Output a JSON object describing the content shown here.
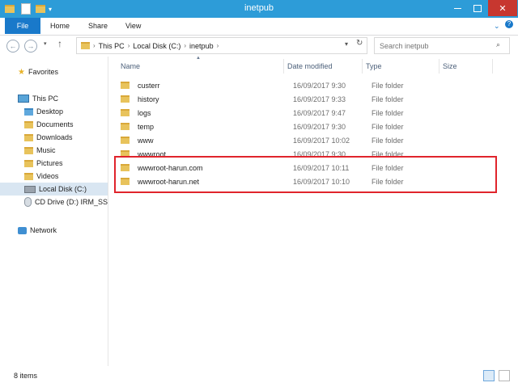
{
  "window": {
    "title": "inetpub"
  },
  "ribbon": {
    "tabs": [
      "File",
      "Home",
      "Share",
      "View"
    ]
  },
  "address": {
    "crumbs": [
      "This PC",
      "Local Disk (C:)",
      "inetpub"
    ],
    "search_placeholder": "Search inetpub"
  },
  "nav": {
    "favorites": "Favorites",
    "this_pc": "This PC",
    "items": [
      "Desktop",
      "Documents",
      "Downloads",
      "Music",
      "Pictures",
      "Videos",
      "Local Disk (C:)",
      "CD Drive (D:) IRM_SS"
    ],
    "network": "Network"
  },
  "columns": {
    "name": "Name",
    "date": "Date modified",
    "type": "Type",
    "size": "Size"
  },
  "files": [
    {
      "name": "custerr",
      "date": "16/09/2017 9:30",
      "type": "File folder"
    },
    {
      "name": "history",
      "date": "16/09/2017 9:33",
      "type": "File folder"
    },
    {
      "name": "logs",
      "date": "16/09/2017 9:47",
      "type": "File folder"
    },
    {
      "name": "temp",
      "date": "16/09/2017 9:30",
      "type": "File folder"
    },
    {
      "name": "www",
      "date": "16/09/2017 10:02",
      "type": "File folder"
    },
    {
      "name": "wwwroot",
      "date": "16/09/2017 9:30",
      "type": "File folder"
    },
    {
      "name": "wwwroot-harun.com",
      "date": "16/09/2017 10:11",
      "type": "File folder"
    },
    {
      "name": "wwwroot-harun.net",
      "date": "16/09/2017 10:10",
      "type": "File folder"
    }
  ],
  "status": {
    "count": "8 items"
  },
  "colors": {
    "titlebar": "#2d9cd8",
    "file_tab": "#1979ca",
    "highlight": "#e0242c",
    "folder": "#e8c35c"
  }
}
